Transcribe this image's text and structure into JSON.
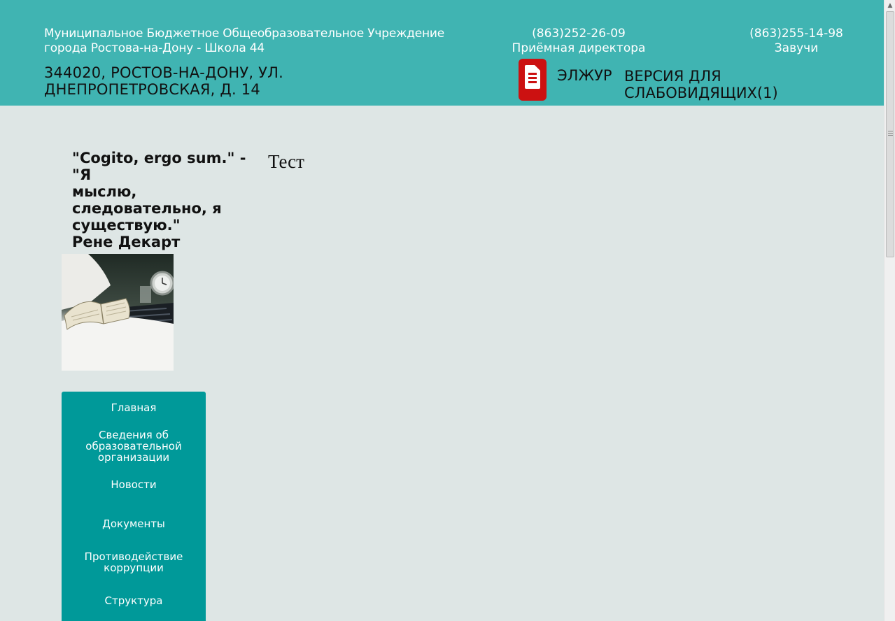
{
  "header": {
    "school_name_line1": "Муниципальное Бюджетное Общеобразовательное Учреждение",
    "school_name_line2": "города Ростова-на-Дону - Школа 44",
    "address_line1": "344020, РОСТОВ-НА-ДОНУ, УЛ.",
    "address_line2": "ДНЕПРОПЕТРОВСКАЯ, Д. 14",
    "phone1": {
      "number": "(863)252-26-09",
      "label": "Приёмная директора"
    },
    "phone2": {
      "number": "(863)255-14-98",
      "label": "Завучи"
    },
    "ejournal": {
      "icon": "document-icon",
      "label": "ЭЛЖУР"
    },
    "vision_link": {
      "line1": "ВЕРСИЯ ДЛЯ",
      "line2": "СЛАБОВИДЯЩИХ(1)"
    }
  },
  "quote": {
    "line1": "\"Cogito, ergo sum.\" - \"Я",
    "line2": "мыслю,",
    "line3": "следовательно, я",
    "line4": "существую.\"",
    "author": "Рене Декарт"
  },
  "test_text": "Тест",
  "nav": {
    "items": [
      {
        "line1": "Главная"
      },
      {
        "line1": "Сведения об",
        "line2": "образовательной",
        "line3": "организации"
      },
      {
        "line1": "Новости"
      },
      {
        "line1": "Документы"
      },
      {
        "line1": "Противодействие",
        "line2": "коррупции"
      },
      {
        "line1": "Структура"
      }
    ]
  },
  "colors": {
    "header_bg": "#40b4b2",
    "page_bg": "#dee6e5",
    "nav_bg": "#009999",
    "ejournal_icon": "#cc1111"
  }
}
